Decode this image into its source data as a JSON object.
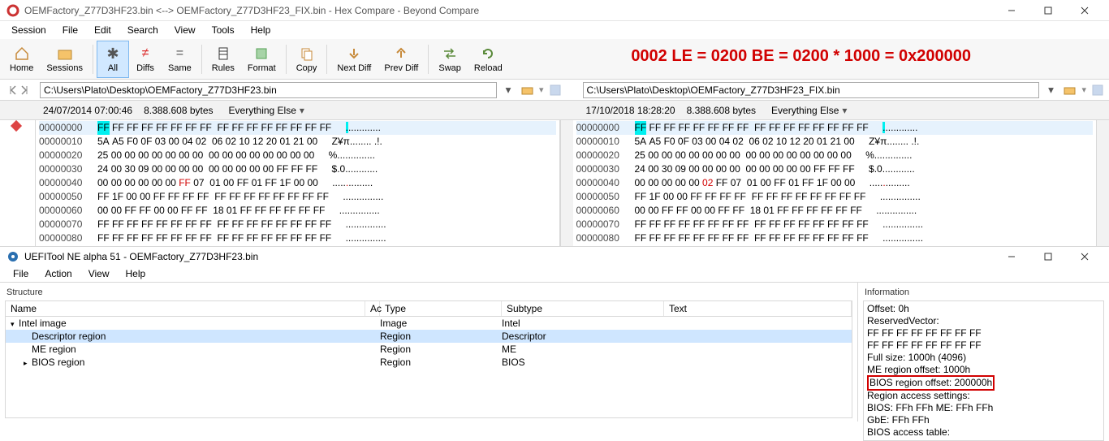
{
  "bc": {
    "title": "OEMFactory_Z77D3HF23.bin <--> OEMFactory_Z77D3HF23_FIX.bin - Hex Compare - Beyond Compare",
    "menu": [
      "Session",
      "File",
      "Edit",
      "Search",
      "View",
      "Tools",
      "Help"
    ],
    "toolbar": {
      "home": "Home",
      "sessions": "Sessions",
      "all": "All",
      "diffs": "Diffs",
      "same": "Same",
      "rules": "Rules",
      "format": "Format",
      "copy": "Copy",
      "nextdiff": "Next Diff",
      "prevdiff": "Prev Diff",
      "swap": "Swap",
      "reload": "Reload"
    },
    "overlay": "0002 LE = 0200 BE = 0200 * 1000 = 0x200000",
    "left": {
      "path": "C:\\Users\\Plato\\Desktop\\OEMFactory_Z77D3HF23.bin",
      "date": "24/07/2014 07:00:46",
      "size": "8.388.608 bytes",
      "filter": "Everything Else",
      "rows": [
        {
          "addr": "00000000",
          "b": "FF FF FF FF FF FF FF FF  FF FF FF FF FF FF FF FF",
          "a": ".............",
          "hl": [
            0
          ]
        },
        {
          "addr": "00000010",
          "b": "5A A5 F0 0F 03 00 04 02  06 02 10 12 20 01 21 00",
          "a": "Z¥π........ .!."
        },
        {
          "addr": "00000020",
          "b": "25 00 00 00 00 00 00 00  00 00 00 00 00 00 00 00",
          "a": "%.............."
        },
        {
          "addr": "00000030",
          "b": "24 00 30 09 00 00 00 00  00 00 00 00 00 FF FF FF",
          "a": "$.0............"
        },
        {
          "addr": "00000040",
          "b": "00 00 00 00 00 00 FF 07  01 00 FF 01 FF 1F 00 00",
          "a": "...............",
          "red": [
            6
          ]
        },
        {
          "addr": "00000050",
          "b": "FF 1F 00 00 FF FF FF FF  FF FF FF FF FF FF FF FF",
          "a": "..............."
        },
        {
          "addr": "00000060",
          "b": "00 00 FF FF 00 00 FF FF  18 01 FF FF FF FF FF FF",
          "a": "..............."
        },
        {
          "addr": "00000070",
          "b": "FF FF FF FF FF FF FF FF  FF FF FF FF FF FF FF FF",
          "a": "..............."
        },
        {
          "addr": "00000080",
          "b": "FF FF FF FF FF FF FF FF  FF FF FF FF FF FF FF FF",
          "a": "..............."
        }
      ]
    },
    "right": {
      "path": "C:\\Users\\Plato\\Desktop\\OEMFactory_Z77D3HF23_FIX.bin",
      "date": "17/10/2018 18:28:20",
      "size": "8.388.608 bytes",
      "filter": "Everything Else",
      "rows": [
        {
          "addr": "00000000",
          "b": "FF FF FF FF FF FF FF FF  FF FF FF FF FF FF FF FF",
          "a": ".............",
          "hl": [
            0
          ]
        },
        {
          "addr": "00000010",
          "b": "5A A5 F0 0F 03 00 04 02  06 02 10 12 20 01 21 00",
          "a": "Z¥π........ .!."
        },
        {
          "addr": "00000020",
          "b": "25 00 00 00 00 00 00 00  00 00 00 00 00 00 00 00",
          "a": "%.............."
        },
        {
          "addr": "00000030",
          "b": "24 00 30 09 00 00 00 00  00 00 00 00 00 FF FF FF",
          "a": "$.0............"
        },
        {
          "addr": "00000040",
          "b": "00 00 00 00 00 02 FF 07  01 00 FF 01 FF 1F 00 00",
          "a": "...............",
          "red": [
            5
          ]
        },
        {
          "addr": "00000050",
          "b": "FF 1F 00 00 FF FF FF FF  FF FF FF FF FF FF FF FF",
          "a": "..............."
        },
        {
          "addr": "00000060",
          "b": "00 00 FF FF 00 00 FF FF  18 01 FF FF FF FF FF FF",
          "a": "..............."
        },
        {
          "addr": "00000070",
          "b": "FF FF FF FF FF FF FF FF  FF FF FF FF FF FF FF FF",
          "a": "..............."
        },
        {
          "addr": "00000080",
          "b": "FF FF FF FF FF FF FF FF  FF FF FF FF FF FF FF FF",
          "a": "..............."
        }
      ]
    }
  },
  "ut": {
    "title": "UEFITool NE alpha 51 - OEMFactory_Z77D3HF23.bin",
    "menu": [
      "File",
      "Action",
      "View",
      "Help"
    ],
    "structure_label": "Structure",
    "information_label": "Information",
    "cols": {
      "name": "Name",
      "ac": "Ac",
      "type": "Type",
      "subtype": "Subtype",
      "text": "Text"
    },
    "tree": [
      {
        "name": "Intel image",
        "type": "Image",
        "subtype": "Intel",
        "indent": 0,
        "exp": "v"
      },
      {
        "name": "Descriptor region",
        "type": "Region",
        "subtype": "Descriptor",
        "indent": 1,
        "sel": true
      },
      {
        "name": "ME region",
        "type": "Region",
        "subtype": "ME",
        "indent": 1
      },
      {
        "name": "BIOS region",
        "type": "Region",
        "subtype": "BIOS",
        "indent": 1,
        "exp": ">"
      }
    ],
    "info": [
      "Offset: 0h",
      "ReservedVector:",
      "FF FF FF FF FF FF FF FF",
      "FF FF FF FF FF FF FF FF",
      "Full size: 1000h (4096)",
      "ME region offset: 1000h",
      {
        "hl": "BIOS region offset: 200000h"
      },
      "Region access settings:",
      "BIOS: FFh FFh ME: FFh FFh",
      "GbE:  FFh FFh",
      "BIOS access table:"
    ]
  }
}
